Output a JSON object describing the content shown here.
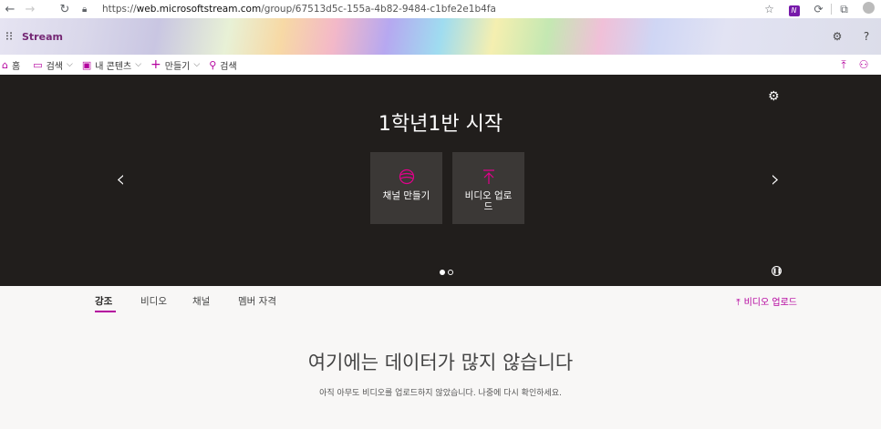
{
  "browser": {
    "url_prefix": "https://",
    "url_host": "web.microsoftstream.com",
    "url_path": "/group/67513d5c-155a-4b82-9484-c1bfe2e1b4fa",
    "icons": [
      "back-icon",
      "forward-icon",
      "refresh-icon",
      "lock-icon",
      "favorite-icon",
      "extension-icon",
      "collections-icon",
      "profile-icon"
    ]
  },
  "stream": {
    "title": "Stream",
    "gear": "⚙",
    "help": "?"
  },
  "cmdbar": {
    "home_label": "홈",
    "browse_label": "검색",
    "mycontent_label": "내 콘텐츠",
    "create_label": "만들기",
    "search_label": "검색"
  },
  "hero": {
    "title": "1학년1반 시작",
    "cards": [
      {
        "label": "채널 만들기",
        "icon": "channel-icon"
      },
      {
        "label": "비디오 업로드",
        "icon": "upload-icon"
      }
    ]
  },
  "tabs": [
    {
      "label": "강조",
      "active": true
    },
    {
      "label": "비디오",
      "active": false
    },
    {
      "label": "채널",
      "active": false
    },
    {
      "label": "멤버 자격",
      "active": false
    }
  ],
  "upload_link": "비디오 업로드",
  "empty": {
    "title": "여기에는 데이터가 많지 않습니다",
    "subtitle": "아직 아무도 비디오를 업로드하지 않았습니다. 나중에 다시 확인하세요."
  },
  "colors": {
    "accent": "#b4009e",
    "brand": "#742774",
    "hero_bg": "#211e1c",
    "card_bg": "#3b3836"
  }
}
